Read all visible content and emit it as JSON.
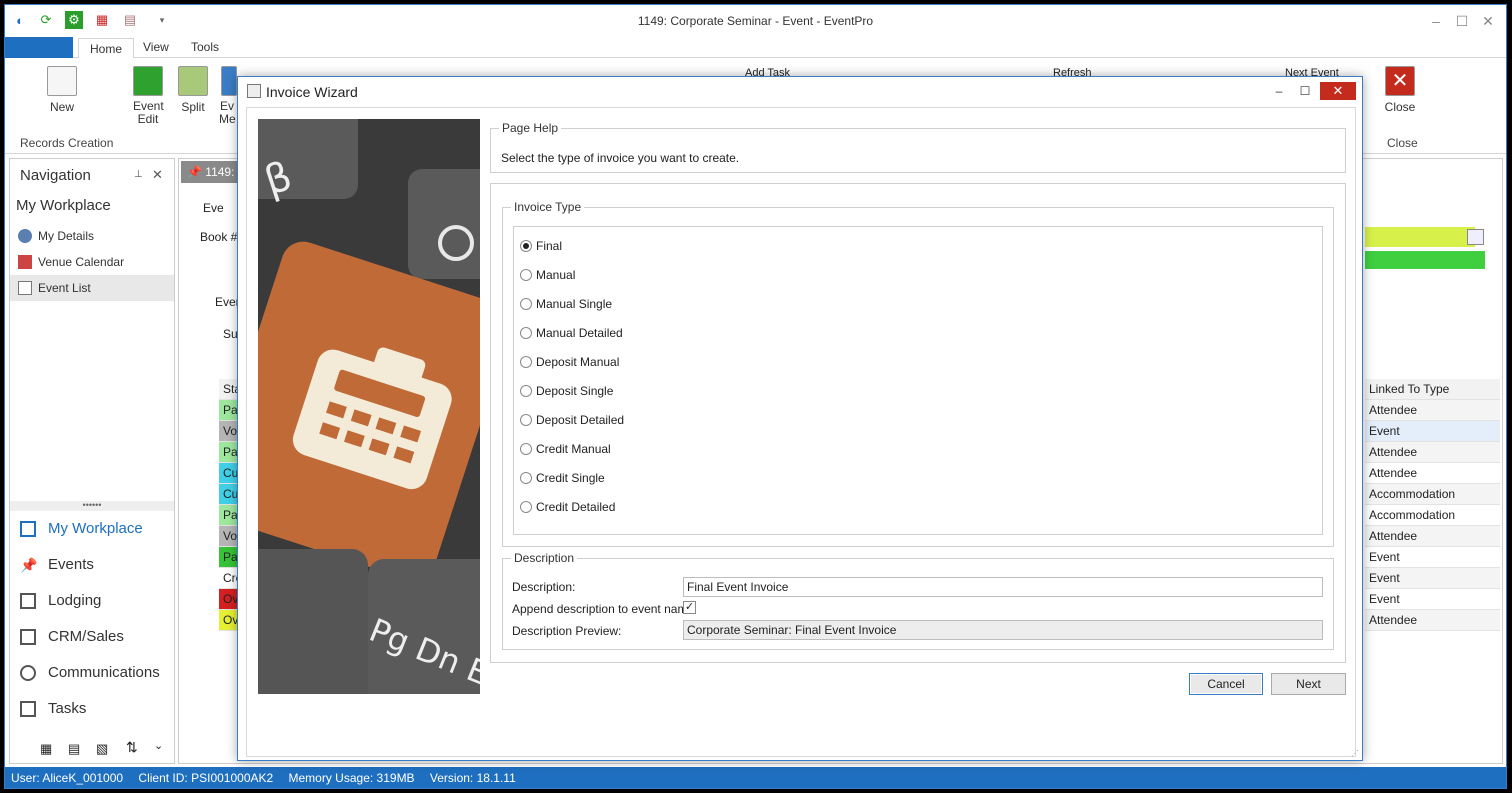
{
  "window": {
    "title": "1149: Corporate Seminar - Event - EventPro"
  },
  "ribbon": {
    "tabs": [
      "Home",
      "View",
      "Tools"
    ],
    "new_label": "New",
    "event_edit_label": "Event Edit",
    "split_label": "Split",
    "event_menu_label": "Ev Me",
    "add_task_label": "Add Task",
    "refresh_label": "Refresh",
    "next_event_label": "Next Event",
    "close_label": "Close",
    "group_records": "Records Creation",
    "group_close": "Close"
  },
  "navigation": {
    "header": "Navigation",
    "section": "My Workplace",
    "items": [
      "My Details",
      "Venue Calendar",
      "Event List"
    ],
    "modules": [
      "My Workplace",
      "Events",
      "Lodging",
      "CRM/Sales",
      "Communications",
      "Tasks"
    ]
  },
  "background": {
    "doc_tab": "1149:",
    "event_box_label": "Eve",
    "book_label": "Book #:",
    "events_tab": "Even",
    "summary_tab": "Sum",
    "status_header": "Stat",
    "status_rows": [
      "Part",
      "Void",
      "Part",
      "Curr",
      "Curr",
      "Part",
      "Void",
      "Paid",
      "Cred",
      "Ove",
      "Ove"
    ],
    "linked_header": "Linked To Type",
    "linked_rows": [
      "Attendee",
      "Event",
      "Attendee",
      "Attendee",
      "Accommodation Booking",
      "Accommodation Booking",
      "Attendee",
      "Event",
      "Event",
      "Event",
      "Attendee"
    ]
  },
  "dialog": {
    "title": "Invoice Wizard",
    "page_help_legend": "Page Help",
    "page_help_text": "Select the type of invoice you want to create.",
    "invoice_type_legend": "Invoice Type",
    "invoice_types": [
      "Final",
      "Manual",
      "Manual Single",
      "Manual Detailed",
      "Deposit Manual",
      "Deposit Single",
      "Deposit Detailed",
      "Credit Manual",
      "Credit Single",
      "Credit Detailed"
    ],
    "selected_type": "Final",
    "description_legend": "Description",
    "description_label": "Description:",
    "description_value": "Final Event Invoice",
    "append_label": "Append description to event name",
    "append_checked": true,
    "preview_label": "Description Preview:",
    "preview_value": "Corporate Seminar: Final Event Invoice",
    "cancel_label": "Cancel",
    "next_label": "Next",
    "image_keys": [
      "β",
      "Pg Dn E"
    ]
  },
  "statusbar": {
    "user": "User: AliceK_001000",
    "client": "Client ID: PSI001000AK2",
    "memory": "Memory Usage: 319MB",
    "version": "Version: 18.1.11"
  },
  "colors": {
    "accent": "#1e6fbf",
    "close_red": "#c42b1c"
  }
}
